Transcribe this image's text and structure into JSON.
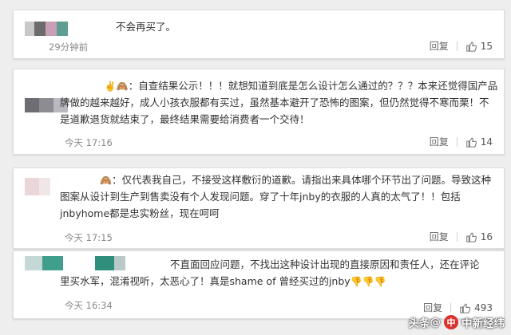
{
  "colors": {
    "link": "#2a6fb8",
    "text": "#333333",
    "muted": "#888888",
    "background": "#eeeeee",
    "watermark_logo": "#d9322b"
  },
  "comments": [
    {
      "text_lines": [
        "不会再买了。"
      ],
      "time": "29分钟前",
      "reply_label": "回复",
      "likes": "15",
      "thumb_icon": "thumb-up-icon"
    },
    {
      "prefix": "",
      "emoji": "✌️🙈",
      "text_lines": [
        "：自查结果公示！！！就想知道到底是怎么设计怎么通过的？？？本来还觉得国产品",
        "牌做的越来越好，成人小孩衣服都有买过，虽然基本避开了恐怖的图案，但仍然觉得不寒而栗！不",
        "是道歉退货就结束了，最终结果需要给消费者一个交待！"
      ],
      "time": "今天 17:16",
      "reply_label": "回复",
      "likes": "14",
      "thumb_icon": "thumb-up-icon"
    },
    {
      "emoji": "🙈",
      "text_lines": [
        "：仅代表我自己，不接受这样敷衍的道歉。请指出来具体哪个环节出了问题。导致这种",
        "图案从设计到生产到售卖没有个人发现问题。穿了十年jnby的衣服的人真的太气了！！包括",
        "jnbyhome都是忠实粉丝，现在呵呵"
      ],
      "time": "今天 17:15",
      "reply_label": "回复",
      "likes": "16",
      "thumb_icon": "thumb-up-icon"
    },
    {
      "text_lines": [
        "不直面回应问题，不找出这种设计出现的直接原因和责任人，还在评论",
        "里买水军，混淆视听，太恶心了！真是shame of 曾经买过的jnby"
      ],
      "trailing_emoji": "👎👎👎",
      "time": "今天 16:34",
      "reply_label": "回复",
      "likes": "493",
      "thumb_icon": "thumb-up-icon"
    }
  ],
  "watermark": {
    "prefix": "头条",
    "at": "@",
    "source": "中新经纬"
  }
}
